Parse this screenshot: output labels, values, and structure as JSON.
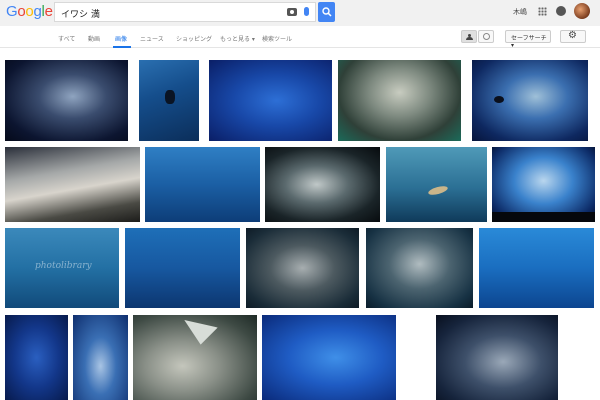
{
  "header": {
    "logo": "Google",
    "search_query": "イワシ 満",
    "user_name": "木嶋"
  },
  "tabs": [
    {
      "label": "すべて",
      "active": false
    },
    {
      "label": "動画",
      "active": false
    },
    {
      "label": "画像",
      "active": true
    },
    {
      "label": "ニュース",
      "active": false
    },
    {
      "label": "ショッピング",
      "active": false
    },
    {
      "label": "もっと見る ▾",
      "active": false
    },
    {
      "label": "検索ツール",
      "active": false
    }
  ],
  "toolbar": {
    "safesearch_label": "セーフサーチ ▾"
  },
  "results": {
    "watermark": "photolibrary",
    "images": [
      {
        "subject": "sardine school dark water"
      },
      {
        "subject": "diver with sardine school"
      },
      {
        "subject": "blue water sardines"
      },
      {
        "subject": "sardine ball aquarium tank"
      },
      {
        "subject": "sardine swirl with rays"
      },
      {
        "subject": "dense sardine school closeup"
      },
      {
        "subject": "blue sardine school"
      },
      {
        "subject": "sardines silver closeup"
      },
      {
        "subject": "manta ray with sardines"
      },
      {
        "subject": "sardine tornado aquarium"
      },
      {
        "subject": "sardine school photolibrary"
      },
      {
        "subject": "sardines and sunbeams"
      },
      {
        "subject": "sardine swarm"
      },
      {
        "subject": "silver sardine school"
      },
      {
        "subject": "sardine column"
      },
      {
        "subject": "deep blue sardines"
      },
      {
        "subject": "sardine school vertical"
      },
      {
        "subject": "ray over sardines"
      },
      {
        "subject": "fish swirl blue"
      },
      {
        "subject": "sardine school sideview"
      }
    ]
  }
}
